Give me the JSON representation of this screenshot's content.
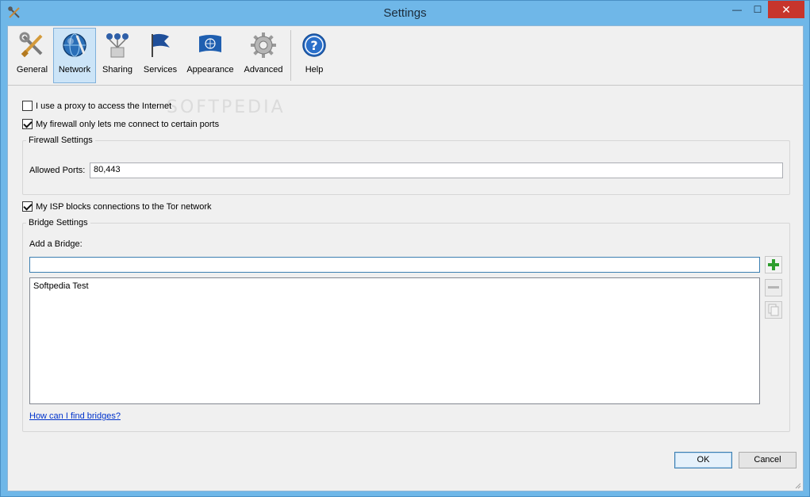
{
  "window": {
    "title": "Settings",
    "minimize_glyph": "—",
    "maximize_glyph": "☐",
    "close_glyph": "✕"
  },
  "toolbar": {
    "items": [
      {
        "label": "General",
        "icon": "tools-icon"
      },
      {
        "label": "Network",
        "icon": "network-globe-icon"
      },
      {
        "label": "Sharing",
        "icon": "sharing-icon"
      },
      {
        "label": "Services",
        "icon": "flag-icon"
      },
      {
        "label": "Appearance",
        "icon": "un-flag-icon"
      },
      {
        "label": "Advanced",
        "icon": "gear-icon"
      },
      {
        "label": "Help",
        "icon": "help-icon"
      }
    ],
    "active": "Network"
  },
  "network": {
    "proxy_label": "I use a proxy to access the Internet",
    "proxy_checked": false,
    "firewall_label": "My firewall only lets me connect to certain ports",
    "firewall_checked": true,
    "firewall_group_title": "Firewall Settings",
    "allowed_ports_label": "Allowed Ports:",
    "allowed_ports_value": "80,443",
    "isp_label": "My ISP blocks connections to the Tor network",
    "isp_checked": true,
    "bridge_group_title": "Bridge Settings",
    "add_bridge_label": "Add a Bridge:",
    "add_bridge_value": "",
    "bridges": [
      "Softpedia Test"
    ],
    "find_bridges_link": "How can I find bridges?"
  },
  "watermark": "SOFTPEDIA",
  "buttons": {
    "ok": "OK",
    "cancel": "Cancel"
  },
  "colors": {
    "titlebar": "#6fb7e8",
    "close": "#c7352c",
    "link": "#0033cc",
    "add_green": "#2e9e2e"
  }
}
